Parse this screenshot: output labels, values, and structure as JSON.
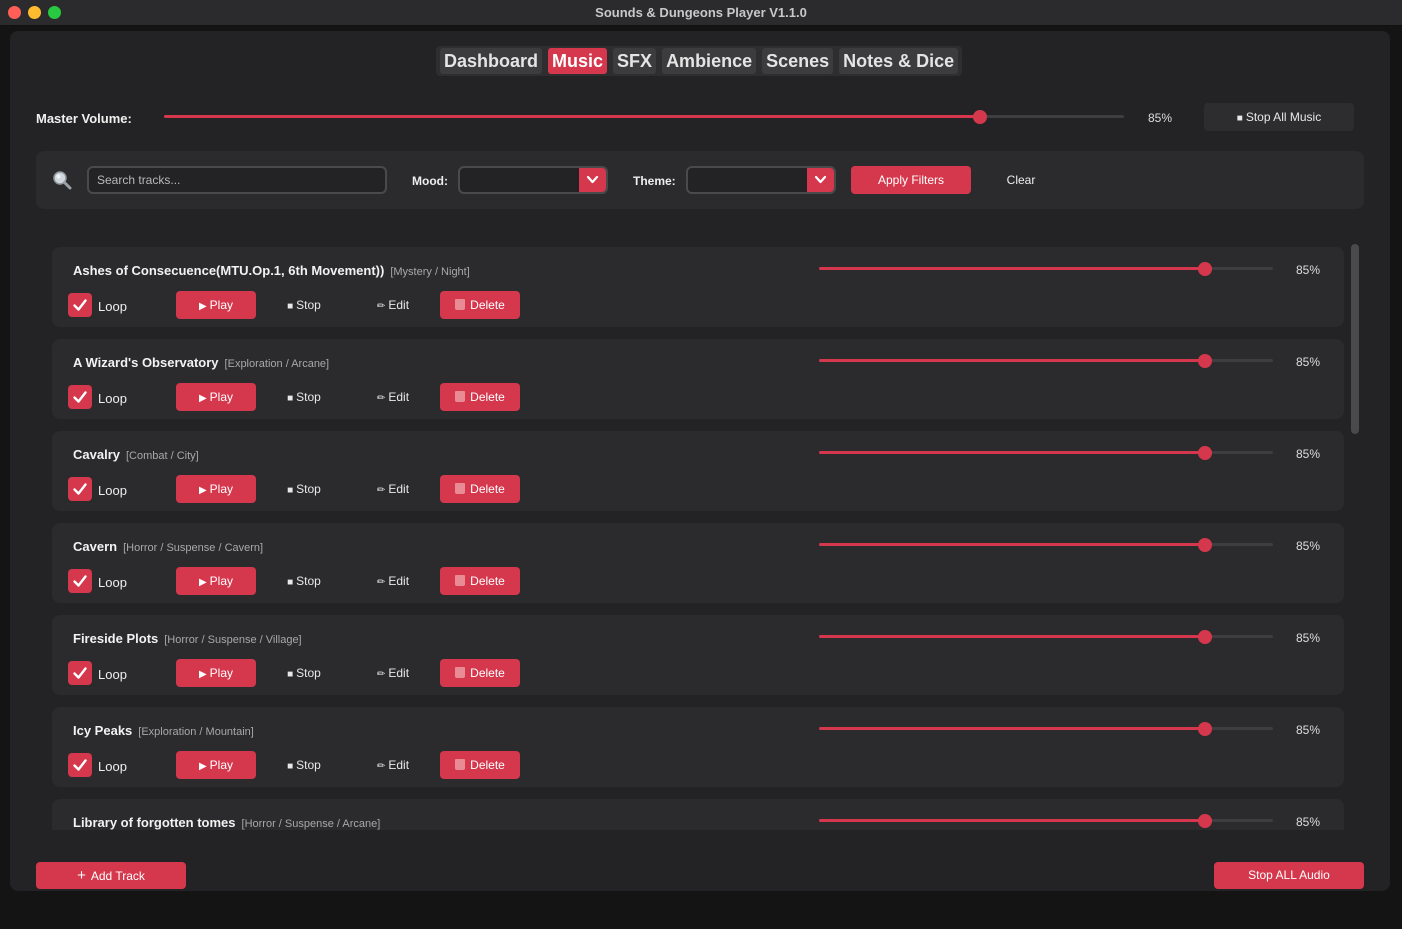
{
  "window": {
    "title": "Sounds & Dungeons Player V1.1.0"
  },
  "tabs": [
    {
      "label": "Dashboard",
      "active": false
    },
    {
      "label": "Music",
      "active": true
    },
    {
      "label": "SFX",
      "active": false
    },
    {
      "label": "Ambience",
      "active": false
    },
    {
      "label": "Scenes",
      "active": false
    },
    {
      "label": "Notes & Dice",
      "active": false
    }
  ],
  "master": {
    "label": "Master Volume:",
    "value": 85,
    "display": "85%",
    "stop_label": "Stop All Music"
  },
  "filters": {
    "search_placeholder": "Search tracks...",
    "mood_label": "Mood:",
    "mood_value": "",
    "theme_label": "Theme:",
    "theme_value": "",
    "apply_label": "Apply Filters",
    "clear_label": "Clear"
  },
  "track_actions": {
    "loop": "Loop",
    "play": "Play",
    "stop": "Stop",
    "edit": "Edit",
    "delete": "Delete"
  },
  "tracks": [
    {
      "name": "Ashes of Consecuence(MTU.Op.1, 6th Movement))",
      "tags": "[Mystery / Night]",
      "volume": 85,
      "volume_display": "85%",
      "loop": true
    },
    {
      "name": "A Wizard's Observatory",
      "tags": "[Exploration / Arcane]",
      "volume": 85,
      "volume_display": "85%",
      "loop": true
    },
    {
      "name": "Cavalry",
      "tags": "[Combat / City]",
      "volume": 85,
      "volume_display": "85%",
      "loop": true
    },
    {
      "name": "Cavern",
      "tags": "[Horror / Suspense / Cavern]",
      "volume": 85,
      "volume_display": "85%",
      "loop": true
    },
    {
      "name": "Fireside Plots",
      "tags": "[Horror / Suspense / Village]",
      "volume": 85,
      "volume_display": "85%",
      "loop": true
    },
    {
      "name": "Icy Peaks",
      "tags": "[Exploration / Mountain]",
      "volume": 85,
      "volume_display": "85%",
      "loop": true
    },
    {
      "name": "Library of forgotten tomes",
      "tags": "[Horror / Suspense / Arcane]",
      "volume": 85,
      "volume_display": "85%",
      "loop": true
    }
  ],
  "footer": {
    "add_track": "Add Track",
    "stop_all_audio": "Stop ALL Audio"
  },
  "colors": {
    "accent": "#d5384c",
    "panel": "#2b2b2d",
    "background": "#232325"
  }
}
